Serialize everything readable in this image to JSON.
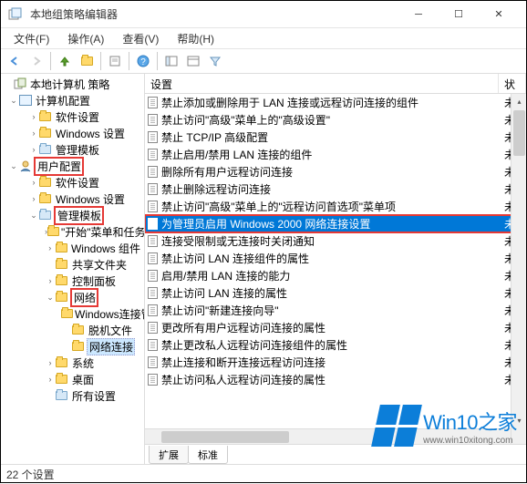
{
  "window": {
    "title": "本地组策略编辑器"
  },
  "menu": {
    "file": "文件(F)",
    "action": "操作(A)",
    "view": "查看(V)",
    "help": "帮助(H)"
  },
  "tree": {
    "root": "本地计算机 策略",
    "computerCfg": "计算机配置",
    "cSoftware": "软件设置",
    "cWindows": "Windows 设置",
    "cAdmin": "管理模板",
    "userCfg": "用户配置",
    "uSoftware": "软件设置",
    "uWindows": "Windows 设置",
    "uAdmin": "管理模板",
    "startMenu": "\"开始\"菜单和任务栏",
    "winComp": "Windows 组件",
    "shared": "共享文件夹",
    "ctrlPanel": "控制面板",
    "network": "网络",
    "winConnMgr": "Windows连接管理器",
    "offline": "脱机文件",
    "netConn": "网络连接",
    "system": "系统",
    "desktop": "桌面",
    "allSettings": "所有设置"
  },
  "list": {
    "headerSetting": "设置",
    "headerState": "状态",
    "stateShort": "未",
    "items": [
      "禁止添加或删除用于 LAN 连接或远程访问连接的组件",
      "禁止访问\"高级\"菜单上的\"高级设置\"",
      "禁止 TCP/IP 高级配置",
      "禁止启用/禁用 LAN 连接的组件",
      "删除所有用户远程访问连接",
      "禁止删除远程访问连接",
      "禁止访问\"高级\"菜单上的\"远程访问首选项\"菜单项",
      "为管理员启用 Windows 2000 网络连接设置",
      "连接受限制或无连接时关闭通知",
      "禁止访问 LAN 连接组件的属性",
      "启用/禁用 LAN 连接的能力",
      "禁止访问 LAN 连接的属性",
      "禁止访问\"新建连接向导\"",
      "更改所有用户远程访问连接的属性",
      "禁止更改私人远程访问连接组件的属性",
      "禁止连接和断开连接远程访问连接",
      "禁止访问私人远程访问连接的属性"
    ],
    "selectedIndex": 7
  },
  "tabs": {
    "extended": "扩展",
    "standard": "标准"
  },
  "status": "22 个设置",
  "watermark": {
    "brand": "Win10之家",
    "url": "www.win10xitong.com"
  }
}
